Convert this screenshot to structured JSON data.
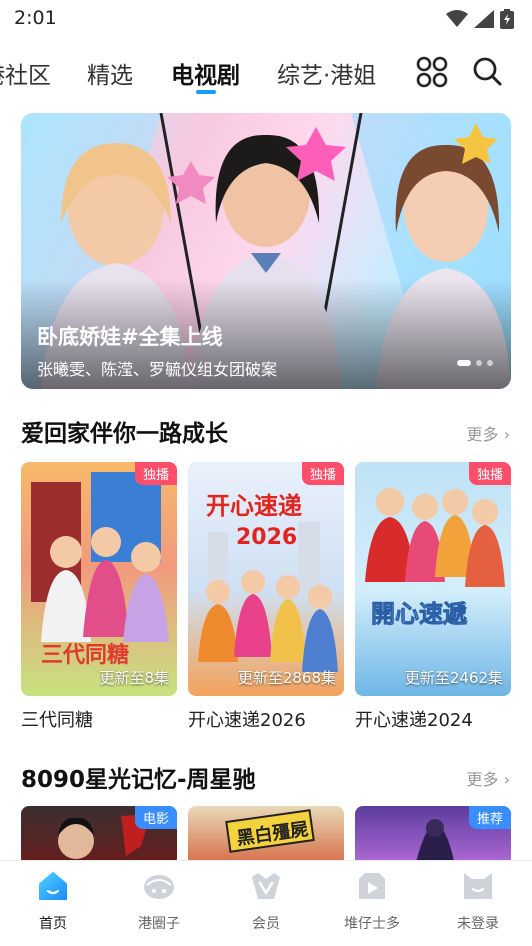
{
  "status": {
    "time": "2:01"
  },
  "tabs": [
    {
      "label": "港社区"
    },
    {
      "label": "精选"
    },
    {
      "label": "电视剧"
    },
    {
      "label": "综艺·港姐"
    }
  ],
  "banner": {
    "title": "卧底娇娃#全集上线",
    "subtitle": "张曦雯、陈滢、罗毓仪组女团破案"
  },
  "section1": {
    "title": "爱回家伴你一路成长",
    "more": "更多",
    "cards": [
      {
        "title": "三代同糖",
        "badge": "独播",
        "caption": "更新至8集",
        "poster_text": "三代同糖"
      },
      {
        "title": "开心速递2026",
        "badge": "独播",
        "caption": "更新至2868集",
        "poster_text": "开心速递",
        "poster_year": "2026"
      },
      {
        "title": "开心速递2024",
        "badge": "独播",
        "caption": "更新至2462集",
        "poster_text": "開心速遞"
      }
    ]
  },
  "section2": {
    "title": "8090星光记忆-周星驰",
    "more": "更多",
    "cards": [
      {
        "badge": "电影"
      },
      {
        "badge": "",
        "poster_text": "黑白殭屍"
      },
      {
        "badge": "推荐"
      }
    ]
  },
  "nav": [
    {
      "label": "首页",
      "icon": "home-icon"
    },
    {
      "label": "港圈子",
      "icon": "circle-icon"
    },
    {
      "label": "会员",
      "icon": "vip-icon"
    },
    {
      "label": "堆仔士多",
      "icon": "store-icon"
    },
    {
      "label": "未登录",
      "icon": "profile-icon"
    }
  ],
  "colors": {
    "accent": "#1a9bff",
    "badge": "#ff4d6a",
    "badge_blue": "#3a8dff"
  }
}
